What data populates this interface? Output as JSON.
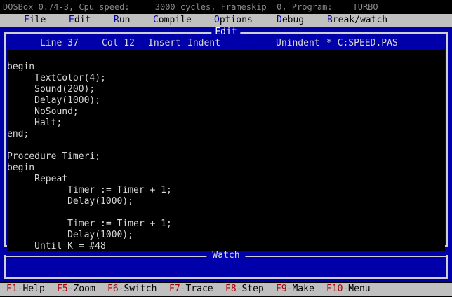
{
  "titlebar": {
    "text": "DOSBox 0.74-3, Cpu speed:     3000 cycles, Frameskip  0, Program:    TURBO"
  },
  "menu": [
    {
      "hot": "F",
      "rest": "ile"
    },
    {
      "hot": "E",
      "rest": "dit"
    },
    {
      "hot": "R",
      "rest": "un"
    },
    {
      "hot": "C",
      "rest": "ompile"
    },
    {
      "hot": "O",
      "rest": "ptions"
    },
    {
      "hot": "D",
      "rest": "ebug"
    },
    {
      "hot": "B",
      "rest": "reak/watch"
    }
  ],
  "editor": {
    "title": "Edit",
    "line": "Line 37",
    "col": "Col 12",
    "insert": "Insert",
    "indent": "Indent",
    "unindent": "Unindent",
    "file": "* C:SPEED.PAS",
    "code": [
      "",
      "begin",
      "     TextColor(4);",
      "     Sound(200);",
      "     Delay(1000);",
      "     NoSound;",
      "     Halt;",
      "end;",
      "",
      "Procedure Timeri;",
      "begin",
      "     Repeat",
      "           Timer := Timer + 1;",
      "           Delay(1000);",
      "",
      "           Timer := Timer + 1;",
      "           Delay(1000);",
      "     Until K = #48"
    ]
  },
  "watch": {
    "title": "Watch"
  },
  "fkeys": [
    {
      "key": "F1",
      "label": "-Help"
    },
    {
      "key": "F5",
      "label": "-Zoom"
    },
    {
      "key": "F6",
      "label": "-Switch"
    },
    {
      "key": "F7",
      "label": "-Trace"
    },
    {
      "key": "F8",
      "label": "-Step"
    },
    {
      "key": "F9",
      "label": "-Make"
    },
    {
      "key": "F10",
      "label": "-Menu"
    }
  ]
}
